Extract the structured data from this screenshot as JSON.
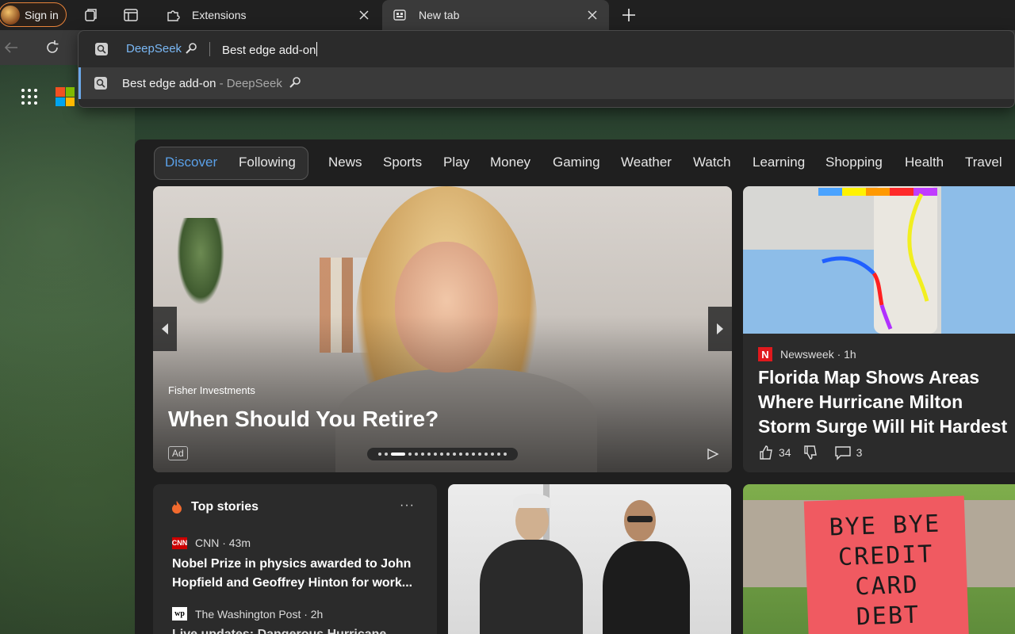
{
  "browser": {
    "signin_label": "Sign in",
    "tabs": [
      {
        "label": "Extensions",
        "icon": "puzzle-icon"
      },
      {
        "label": "New tab",
        "icon": "newtab-icon"
      }
    ]
  },
  "omnibox": {
    "engine": "DeepSeek",
    "query": "Best edge add-on",
    "suggestion": {
      "text": "Best edge add-on",
      "separator": "-",
      "engine": "DeepSeek"
    }
  },
  "feed": {
    "tabs": [
      "Discover",
      "Following",
      "News",
      "Sports",
      "Play",
      "Money",
      "Gaming",
      "Weather",
      "Watch",
      "Learning",
      "Shopping",
      "Health",
      "Travel"
    ],
    "active_tab": "Discover"
  },
  "hero": {
    "source": "Fisher Investments",
    "title": "When Should You Retire?",
    "badge": "Ad"
  },
  "news_card": {
    "source": "Newsweek",
    "time": "· 1h",
    "title": "Florida Map Shows Areas Where Hurricane Milton Storm Surge Will Hit Hardest",
    "likes": "34",
    "comments": "3"
  },
  "top_stories": {
    "heading": "Top stories",
    "more": "···",
    "items": [
      {
        "source": "CNN · 43m",
        "logo": "CNN",
        "title": "Nobel Prize in physics awarded to John Hopfield and Geoffrey Hinton for work..."
      },
      {
        "source": "The Washington Post · 2h",
        "logo": "wp",
        "title": "Live updates: Dangerous Hurricane"
      }
    ]
  },
  "sign_card": {
    "lines": [
      "BYE BYE",
      "CREDIT",
      "CARD",
      "DEBT"
    ]
  }
}
